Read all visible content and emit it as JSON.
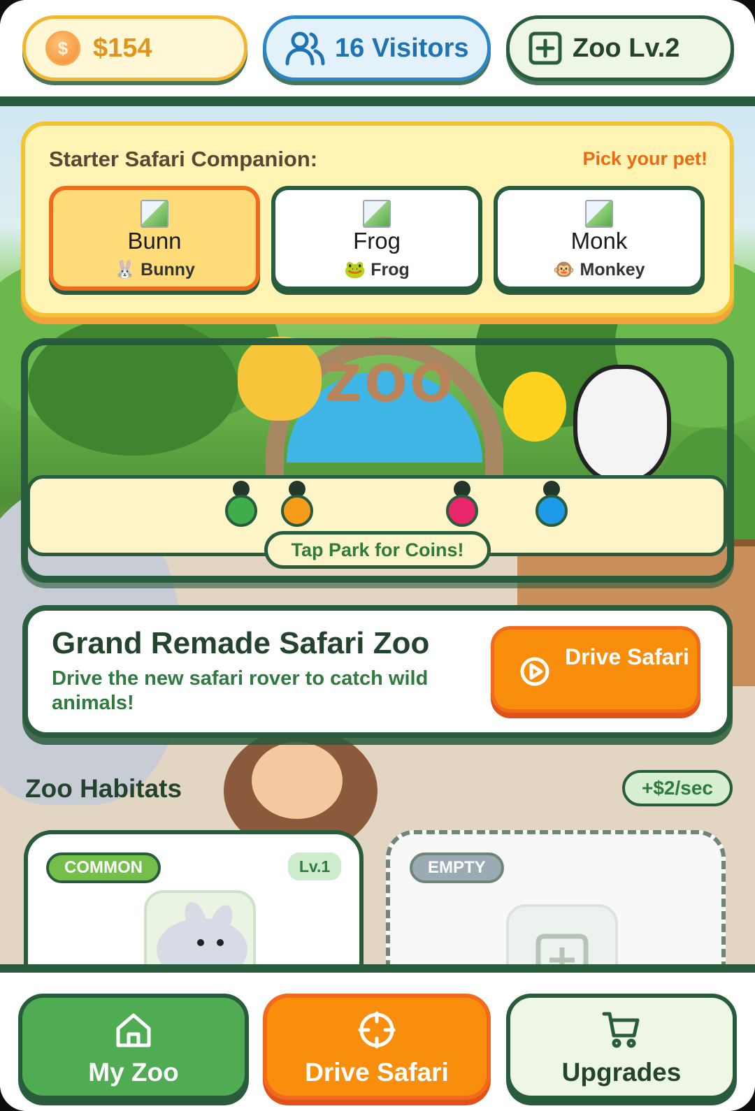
{
  "topbar": {
    "coins": "$154",
    "visitors": "16 Visitors",
    "level": "Zoo Lv.2"
  },
  "starter": {
    "title": "Starter Safari Companion:",
    "hint": "Pick your pet!",
    "pets": [
      {
        "name": "Bunn",
        "label": "Bunny",
        "emoji": "🐰",
        "selected": true
      },
      {
        "name": "Frog",
        "label": "Frog",
        "emoji": "🐸",
        "selected": false
      },
      {
        "name": "Monk",
        "label": "Monkey",
        "emoji": "🐵",
        "selected": false
      }
    ]
  },
  "park": {
    "sign": "ZOO",
    "tap_label": "Tap Park for Coins!",
    "visitor_colors": [
      "#3fae4a",
      "#f79c1a",
      "#e8266b",
      "#1e9be8"
    ]
  },
  "feature": {
    "title": "Grand Remade Safari Zoo",
    "description": "Drive the new safari rover to catch wild animals!",
    "button": "Drive Safari"
  },
  "habitats": {
    "title": "Zoo Habitats",
    "income": "+$2/sec",
    "cards": [
      {
        "tag": "COMMON",
        "level": "Lv.1",
        "animal": "bunny"
      },
      {
        "tag": "EMPTY"
      }
    ]
  },
  "nav": {
    "my_zoo": "My Zoo",
    "drive_safari": "Drive Safari",
    "upgrades": "Upgrades"
  },
  "colors": {
    "dark_green": "#285c3c",
    "orange": "#f98d0c",
    "gold": "#f5c232",
    "blue": "#2b86c6"
  }
}
